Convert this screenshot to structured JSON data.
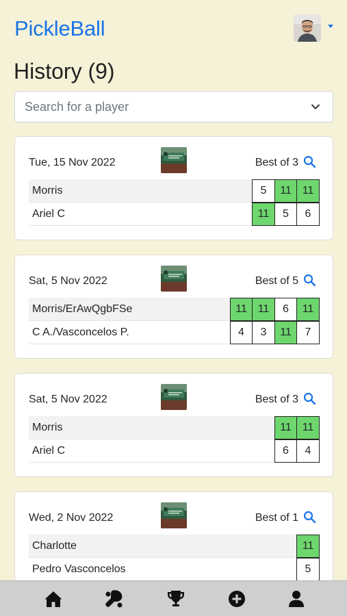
{
  "header": {
    "brand": "PickleBall",
    "profile": {
      "avatar_icon": "user-avatar"
    }
  },
  "page": {
    "title": "History (9)"
  },
  "search": {
    "placeholder": "Search for a player",
    "value": ""
  },
  "colors": {
    "brand": "#1a73e8",
    "win_cell": "#6dd66d",
    "background": "#f5f2d8",
    "navbar": "#cfcfcf"
  },
  "matches": [
    {
      "date": "Tue, 15 Nov 2022",
      "format": "Best of 3",
      "players": [
        {
          "name": "Morris",
          "scores": [
            {
              "v": "5",
              "win": false
            },
            {
              "v": "11",
              "win": true
            },
            {
              "v": "11",
              "win": true
            }
          ]
        },
        {
          "name": "Ariel C",
          "scores": [
            {
              "v": "11",
              "win": true
            },
            {
              "v": "5",
              "win": false
            },
            {
              "v": "6",
              "win": false
            }
          ]
        }
      ]
    },
    {
      "date": "Sat, 5 Nov 2022",
      "format": "Best of 5",
      "players": [
        {
          "name": "Morris/ErAwQgbFSe",
          "scores": [
            {
              "v": "11",
              "win": true
            },
            {
              "v": "11",
              "win": true
            },
            {
              "v": "6",
              "win": false
            },
            {
              "v": "11",
              "win": true
            }
          ]
        },
        {
          "name": "C A./Vasconcelos P.",
          "scores": [
            {
              "v": "4",
              "win": false
            },
            {
              "v": "3",
              "win": false
            },
            {
              "v": "11",
              "win": true
            },
            {
              "v": "7",
              "win": false
            }
          ]
        }
      ]
    },
    {
      "date": "Sat, 5 Nov 2022",
      "format": "Best of 3",
      "players": [
        {
          "name": "Morris",
          "scores": [
            {
              "v": "11",
              "win": true
            },
            {
              "v": "11",
              "win": true
            }
          ]
        },
        {
          "name": "Ariel C",
          "scores": [
            {
              "v": "6",
              "win": false
            },
            {
              "v": "4",
              "win": false
            }
          ]
        }
      ]
    },
    {
      "date": "Wed, 2 Nov 2022",
      "format": "Best of 1",
      "players": [
        {
          "name": "Charlotte",
          "scores": [
            {
              "v": "11",
              "win": true
            }
          ]
        },
        {
          "name": "Pedro Vasconcelos",
          "scores": [
            {
              "v": "5",
              "win": false
            }
          ]
        }
      ]
    }
  ],
  "navbar": {
    "items": [
      {
        "icon": "home-icon"
      },
      {
        "icon": "paddle-icon"
      },
      {
        "icon": "trophy-icon"
      },
      {
        "icon": "add-circle-icon"
      },
      {
        "icon": "user-icon"
      }
    ]
  }
}
